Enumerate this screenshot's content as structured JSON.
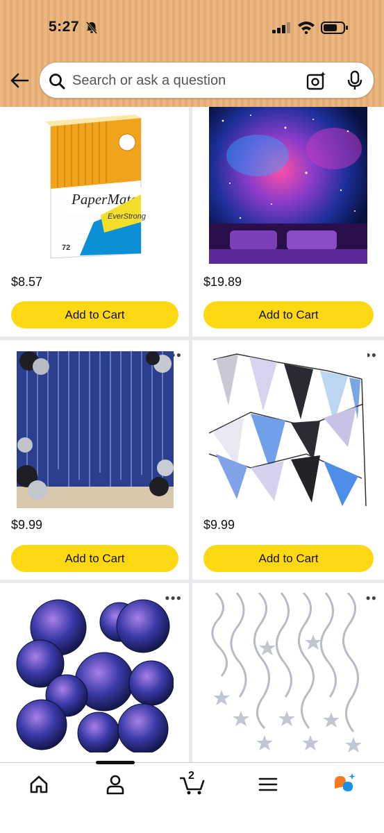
{
  "status_bar": {
    "time": "5:27"
  },
  "search": {
    "placeholder": "Search or ask a question"
  },
  "products": [
    {
      "price": "$8.57",
      "cart_label": "Add to Cart",
      "image": "paper-mate-pencils-box"
    },
    {
      "price": "$19.89",
      "cart_label": "Add to Cart",
      "image": "galaxy-tapestry"
    },
    {
      "price": "$9.99",
      "cart_label": "Add to Cart",
      "image": "blue-foil-curtain-backdrop"
    },
    {
      "price": "$9.99",
      "cart_label": "Add to Cart",
      "image": "pennant-banner"
    },
    {
      "image": "galaxy-paper-lanterns"
    },
    {
      "image": "silver-star-swirls"
    }
  ],
  "product_image_text": {
    "brand": "PaperMate",
    "tagline": "EverStrong",
    "count": "72"
  },
  "bottom_nav": {
    "cart_count": "2"
  },
  "colors": {
    "header": "#e3ab72",
    "cart_button": "#ffd814",
    "accent_orange": "#f47c20",
    "accent_blue": "#1f8fe6"
  }
}
